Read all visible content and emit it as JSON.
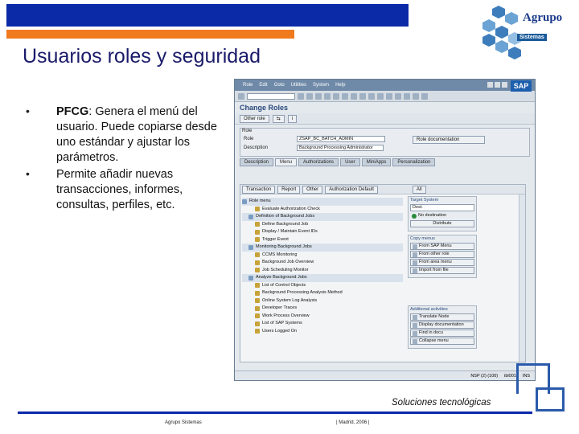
{
  "slide": {
    "title": "Usuarios roles y seguridad",
    "bullets": [
      {
        "bold": "PFCG",
        "text": ": Genera el menú del usuario. Puede copiarse desde uno estándar y ajustar los parámetros."
      },
      {
        "bold": "",
        "text": "Permite añadir nuevas transacciones, informes, consultas, perfiles, etc."
      }
    ],
    "slogan": "Soluciones tecnológicas",
    "footer_left": "Agrupo Sistemas",
    "footer_center": "| Madrid, 2006 |",
    "logo": {
      "name": "Agrupo",
      "sub": "Sistemas"
    },
    "colors": {
      "blue_bar": "#0a2aa8",
      "orange_bar": "#f07a1e"
    }
  },
  "sap": {
    "menu": [
      "Role",
      "Edit",
      "Goto",
      "Utilities",
      "System",
      "Help"
    ],
    "logo": "SAP",
    "screen_title": "Change Roles",
    "app_toolbar": [
      "Other role"
    ],
    "form": {
      "section": "Role",
      "role_label": "Role",
      "role_value": "ZSAP_BC_BATCH_ADMIN",
      "desc_label": "Description",
      "desc_value": "Background Processing Administrator",
      "doc_button": "Role documentation"
    },
    "tabs": [
      "Description",
      "Menu",
      "Authorizations",
      "User",
      "MiniApps",
      "Personalization"
    ],
    "panel_toolbar": [
      "Transaction",
      "Report",
      "Other",
      "Authorization Default",
      "All"
    ],
    "tree": [
      {
        "label": "Role menu",
        "folder": true
      },
      {
        "label": "Evaluate Authorization Check",
        "folder": false
      },
      {
        "label": "Definition of Background Jobs",
        "folder": true
      },
      {
        "label": "Define Background Job",
        "folder": false
      },
      {
        "label": "Display / Maintain Event IDs",
        "folder": false
      },
      {
        "label": "Trigger Event",
        "folder": false
      },
      {
        "label": "Monitoring Background Jobs",
        "folder": true
      },
      {
        "label": "CCMS Monitoring",
        "folder": false
      },
      {
        "label": "Background Job Overview",
        "folder": false
      },
      {
        "label": "Job Scheduling Monitor",
        "folder": false
      },
      {
        "label": "Analyze Background Jobs",
        "folder": true
      },
      {
        "label": "List of Control Objects",
        "folder": false
      },
      {
        "label": "Background Processing Analysis Method",
        "folder": false
      },
      {
        "label": "Online System Log Analysis",
        "folder": false
      },
      {
        "label": "Developer Traces",
        "folder": false
      },
      {
        "label": "Work Process Overview",
        "folder": false
      },
      {
        "label": "List of SAP Systems",
        "folder": false
      },
      {
        "label": "Users Logged On",
        "folder": false
      }
    ],
    "target_system": {
      "header": "Target System",
      "value": "Dest.",
      "status": "No destination",
      "button": "Distribute"
    },
    "copy_menus": {
      "header": "Copy menus",
      "buttons": [
        "From SAP Menu",
        "From other role",
        "From area menu",
        "Import from file"
      ]
    },
    "additional": {
      "header": "Additional activities",
      "buttons": [
        "Translate Node",
        "Display documentation",
        "Find in docu",
        "Collapse menu"
      ]
    },
    "status_bar": [
      "NSP (2) (100)",
      "ibl001",
      "INS"
    ]
  }
}
